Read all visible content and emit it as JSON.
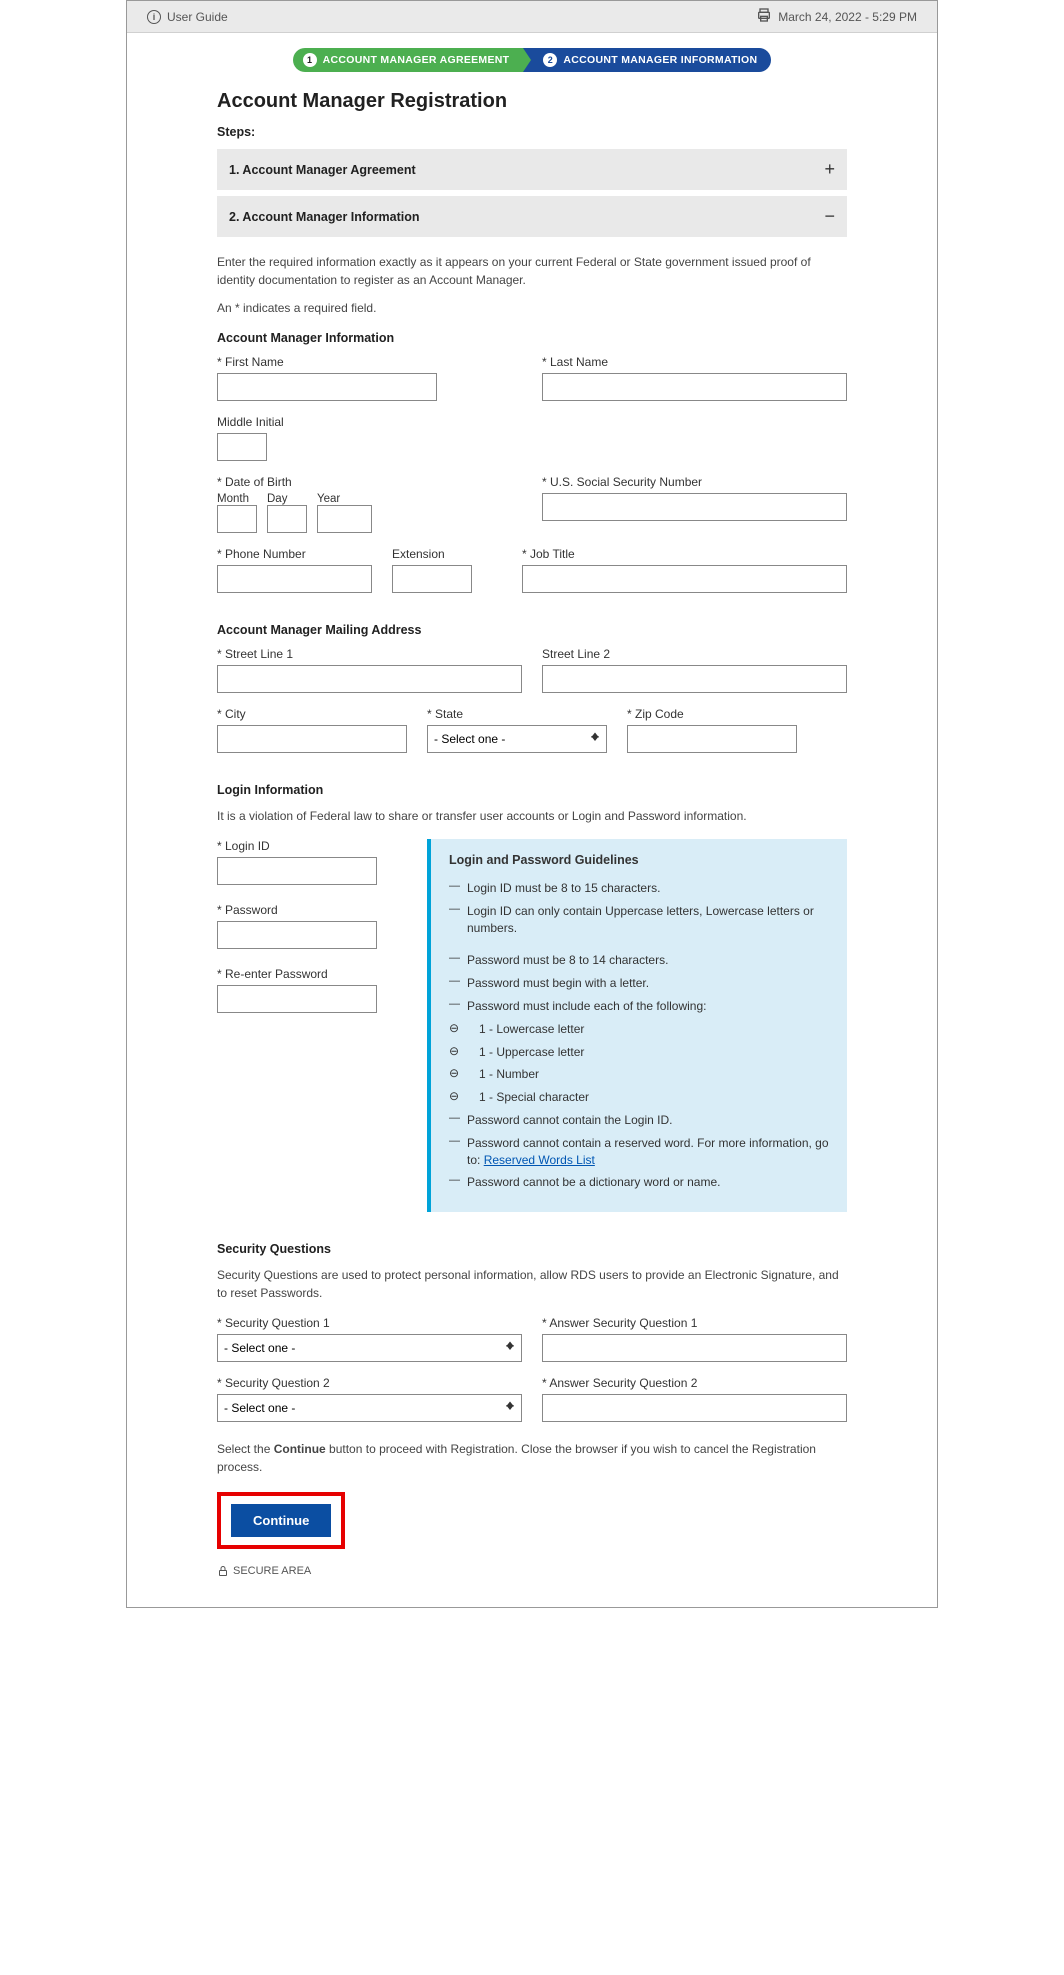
{
  "topbar": {
    "user_guide": "User Guide",
    "datetime": "March 24, 2022 - 5:29 PM"
  },
  "stepper": {
    "step1": "ACCOUNT MANAGER AGREEMENT",
    "step2": "ACCOUNT MANAGER INFORMATION"
  },
  "page_title": "Account Manager Registration",
  "steps_label": "Steps:",
  "accordion": {
    "one": "1. Account Manager Agreement",
    "two": "2. Account Manager Information"
  },
  "intro_text": "Enter the required information exactly as it appears on your current Federal or State government issued proof of identity documentation to register as an Account Manager.",
  "required_note": "An * indicates a required field.",
  "sec_ami": "Account Manager Information",
  "labels": {
    "first_name": "* First Name",
    "last_name": "* Last Name",
    "middle_initial": "Middle Initial",
    "dob": "* Date of Birth",
    "dob_month": "Month",
    "dob_day": "Day",
    "dob_year": "Year",
    "ssn": "* U.S. Social Security Number",
    "phone": "* Phone Number",
    "extension": "Extension",
    "job_title": "* Job Title",
    "street1": "* Street Line 1",
    "street2": "Street Line 2",
    "city": "* City",
    "state": "* State",
    "zip": "* Zip Code",
    "login_id": "* Login ID",
    "password": "* Password",
    "repassword": "* Re-enter Password",
    "sq1": "* Security Question 1",
    "aq1": "* Answer Security Question 1",
    "sq2": "* Security Question 2",
    "aq2": "* Answer Security Question 2"
  },
  "sec_addr": "Account Manager Mailing Address",
  "sec_login": "Login Information",
  "login_violation": "It is a violation of Federal law to share or transfer user accounts or Login and Password information.",
  "guidelines": {
    "title": "Login and Password Guidelines",
    "li1": "Login ID must be 8 to 15 characters.",
    "li2": "Login ID can only contain Uppercase letters, Lowercase letters or numbers.",
    "li3": "Password must be 8 to 14 characters.",
    "li4": "Password must begin with a letter.",
    "li5": "Password must include each of the following:",
    "li5a": "1 - Lowercase letter",
    "li5b": "1 - Uppercase letter",
    "li5c": "1 - Number",
    "li5d": "1 - Special character",
    "li6": "Password cannot contain the Login ID.",
    "li7a": "Password cannot contain a reserved word. For more information, go to: ",
    "li7link": "Reserved Words List",
    "li8": "Password cannot be a dictionary word or name."
  },
  "sec_security": "Security Questions",
  "security_text": "Security Questions are used to protect personal information, allow RDS users to provide an Electronic Signature, and to reset Passwords.",
  "select_placeholder": "- Select one -",
  "continue_text_pre": "Select the ",
  "continue_text_strong": "Continue",
  "continue_text_post": " button to proceed with Registration. Close the browser if you wish to cancel the Registration process.",
  "continue_btn": "Continue",
  "secure_area": "SECURE AREA"
}
